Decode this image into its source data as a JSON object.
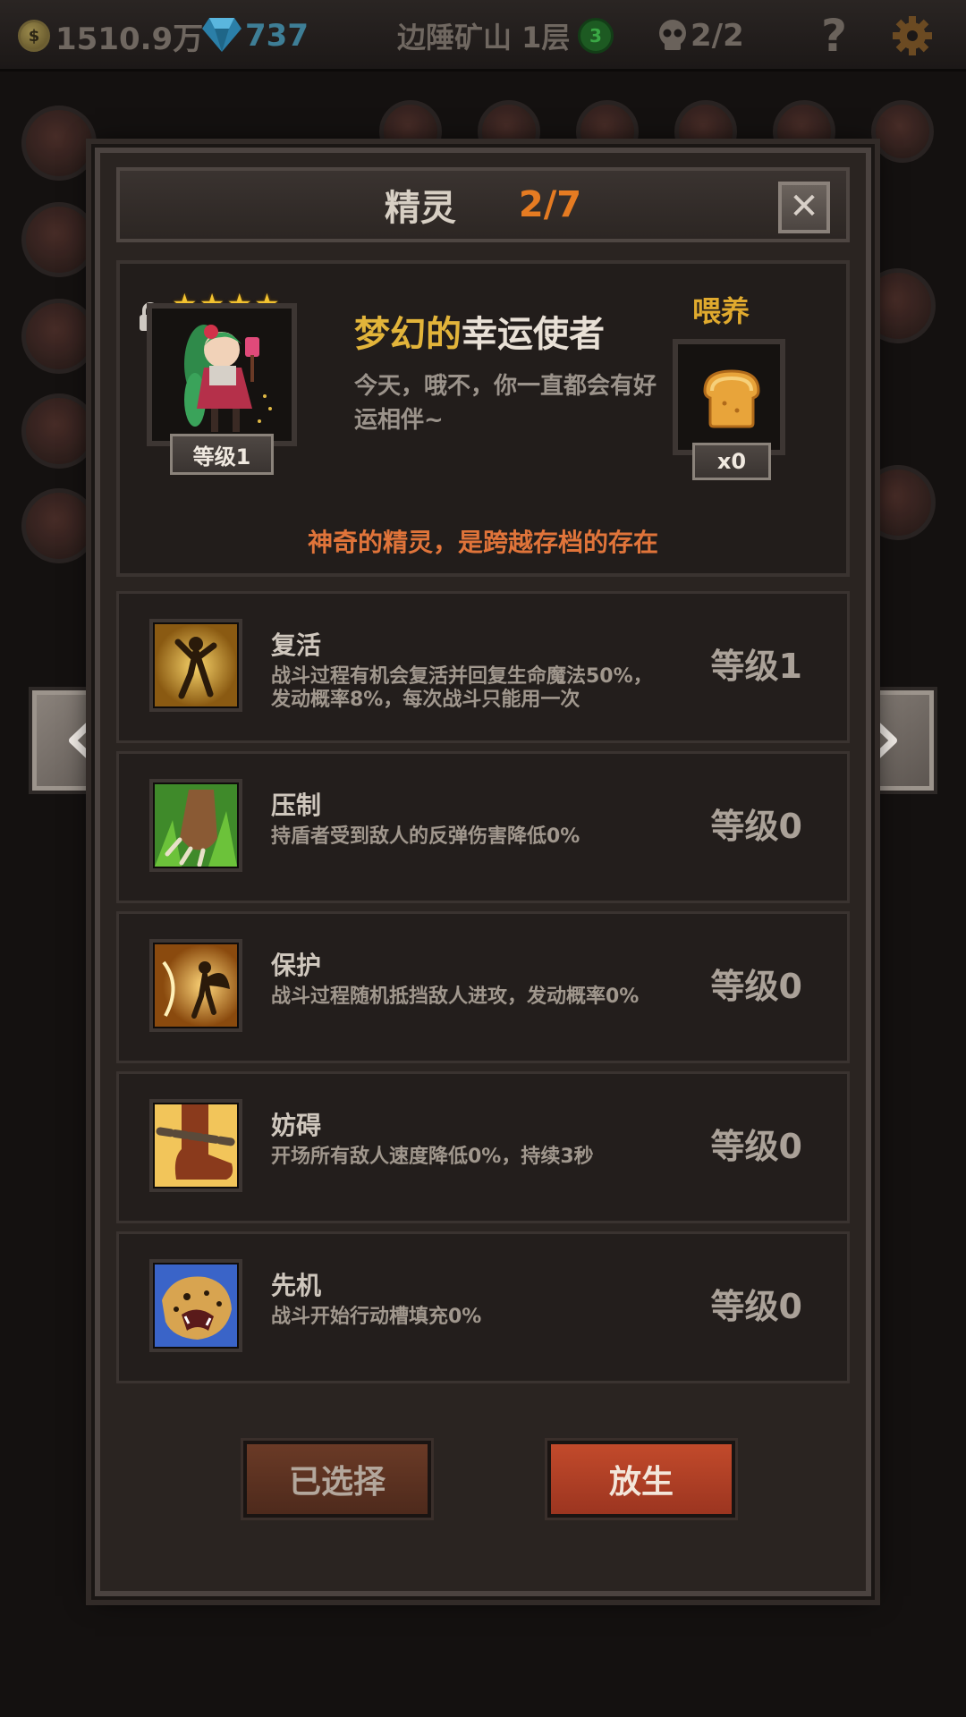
{
  "topbar": {
    "gold": "1510.9万",
    "gems": "737",
    "location": "边陲矿山 1层",
    "badge": "3",
    "skulls": "2/2",
    "help": "?"
  },
  "panel": {
    "title": "精灵",
    "count": "2/7",
    "close": "✕"
  },
  "spirit": {
    "stars": [
      "★",
      "★",
      "★",
      "★"
    ],
    "name_prefix": "梦幻的",
    "name_main": "幸运使者",
    "description": "今天，哦不，你一直都会有好运相伴~",
    "level": "等级1",
    "feed_label": "喂养",
    "feed_count": "x0",
    "note": "神奇的精灵，是跨越存档的存在"
  },
  "skills": [
    {
      "name": "复活",
      "desc": "战斗过程有机会复活并回复生命魔法50%，发动概率8%，每次战斗只能用一次",
      "level": "等级1",
      "icon": "revive-icon"
    },
    {
      "name": "压制",
      "desc": "持盾者受到敌人的反弹伤害降低0%",
      "level": "等级0",
      "icon": "claw-icon"
    },
    {
      "name": "保护",
      "desc": "战斗过程随机抵挡敌人进攻，发动概率0%",
      "level": "等级0",
      "icon": "fairy-shield-icon"
    },
    {
      "name": "妨碍",
      "desc": "开场所有敌人速度降低0%，持续3秒",
      "level": "等级0",
      "icon": "chained-boot-icon"
    },
    {
      "name": "先机",
      "desc": "战斗开始行动槽填充0%",
      "level": "等级0",
      "icon": "leopard-icon"
    }
  ],
  "buttons": {
    "selected": "已选择",
    "release": "放生"
  },
  "colors": {
    "accent_orange": "#e57b22",
    "name_gold": "#e2b43a",
    "note_orange": "#e0743a",
    "release_red": "#c24a2b"
  }
}
